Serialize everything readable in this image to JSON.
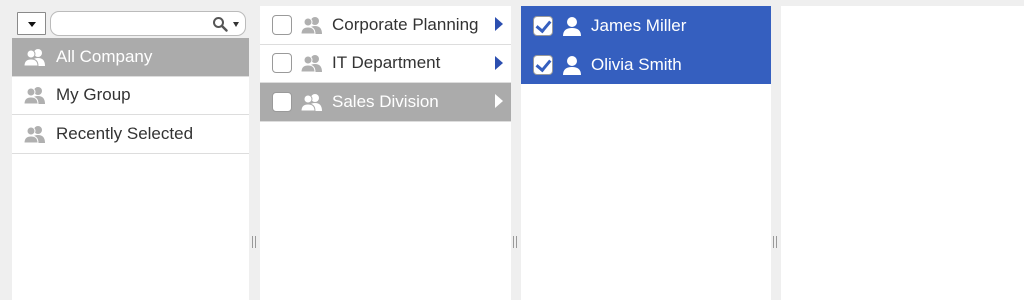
{
  "groups_panel": {
    "search": {
      "value": "",
      "placeholder": ""
    },
    "items": [
      {
        "label": "All Company",
        "selected": true
      },
      {
        "label": "My Group",
        "selected": false
      },
      {
        "label": "Recently Selected",
        "selected": false
      }
    ]
  },
  "departments_panel": {
    "items": [
      {
        "label": "Corporate Planning",
        "checked": false,
        "selected": false
      },
      {
        "label": "IT Department",
        "checked": false,
        "selected": false
      },
      {
        "label": "Sales Division",
        "checked": false,
        "selected": true
      }
    ]
  },
  "users_panel": {
    "items": [
      {
        "label": "James Miller",
        "checked": true
      },
      {
        "label": "Olivia Smith",
        "checked": true
      }
    ]
  },
  "colors": {
    "selection_blue": "#355fbf",
    "selection_gray": "#ababab",
    "arrow_blue": "#2c4fb0"
  }
}
